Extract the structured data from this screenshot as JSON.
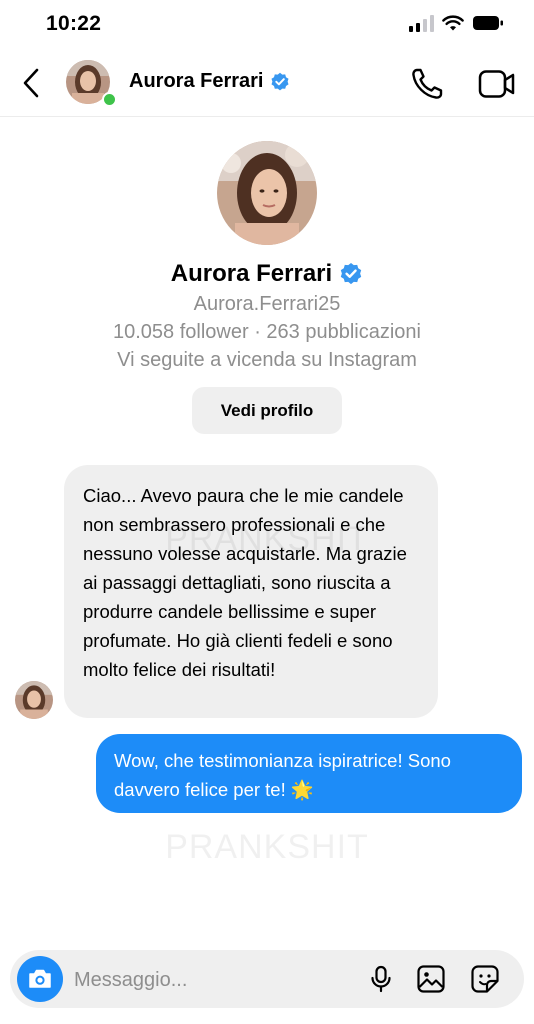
{
  "status_bar": {
    "time": "10:22"
  },
  "header": {
    "name": "Aurora Ferrari",
    "online": true
  },
  "profile": {
    "name": "Aurora Ferrari",
    "username": "Aurora.Ferrari25",
    "stats": "10.058 follower · 263 pubblicazioni",
    "mutual": "Vi seguite a vicenda su Instagram",
    "view_profile_label": "Vedi profilo"
  },
  "messages": [
    {
      "from": "them",
      "text": "Ciao... Avevo paura che le mie candele non sembrassero professionali e che nessuno volesse acquistarle. Ma grazie ai passaggi dettagliati, sono riuscita a produrre candele bellissime e super profumate. Ho già clienti fedeli e sono molto felice dei risultati!"
    },
    {
      "from": "me",
      "text": "Wow, che testimonianza ispiratrice! Sono davvero felice per te! 🌟"
    }
  ],
  "watermark": "PRANKSHIT",
  "composer": {
    "placeholder": "Messaggio..."
  },
  "colors": {
    "accent": "#1d8cf8",
    "bubble_incoming": "#efefef",
    "verified": "#3897f0",
    "online": "#3ec34a"
  },
  "icons": [
    "back-icon",
    "verified-badge-icon",
    "phone-icon",
    "video-icon",
    "camera-icon",
    "microphone-icon",
    "gallery-icon",
    "sticker-icon"
  ]
}
